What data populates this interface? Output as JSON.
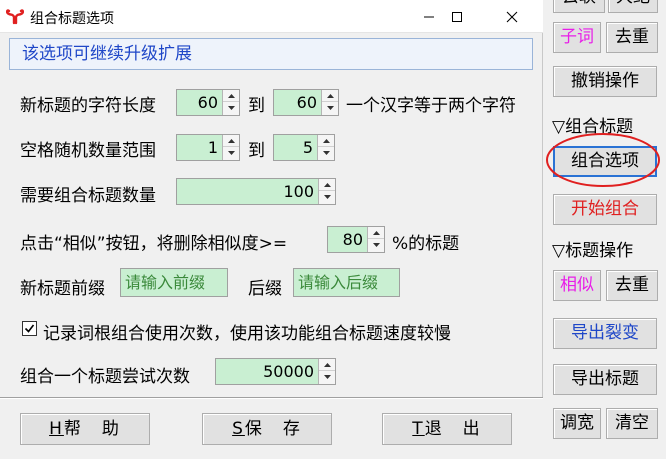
{
  "dialog": {
    "title": "组合标题选项",
    "banner": "该选项可继续升级扩展",
    "rows": {
      "length": {
        "label": "新标题的字符长度",
        "min": "60",
        "to": "到",
        "max": "60",
        "note": "一个汉字等于两个字符"
      },
      "space": {
        "label": "空格随机数量范围",
        "min": "1",
        "to": "到",
        "max": "5"
      },
      "count": {
        "label": "需要组合标题数量",
        "value": "100"
      },
      "similar": {
        "label": "点击“相似”按钮，将删除相似度>=",
        "value": "80",
        "suffix": "%的标题"
      },
      "prefix": {
        "label": "新标题前缀",
        "placeholder": "请输入前缀",
        "suffix_label": "后缀",
        "suffix_placeholder": "请输入后缀"
      },
      "record": {
        "label": "记录词根组合使用次数，使用该功能组合标题速度较慢",
        "checked": true
      },
      "tries": {
        "label": "组合一个标题尝试次数",
        "value": "50000"
      }
    },
    "buttons": {
      "help_key": "H",
      "help": "帮　助",
      "save_key": "S",
      "save": "保　存",
      "exit_key": "T",
      "exit": "退　出"
    }
  },
  "panel": {
    "top_partial_left": "去联",
    "top_partial_right": "大纪",
    "subword": "子词",
    "dedupe1": "去重",
    "undo": "撤销操作",
    "section_combine": "▽组合标题",
    "combine_options": "组合选项",
    "start_combine": "开始组合",
    "section_title_ops": "▽标题操作",
    "similar": "相似",
    "dedupe2": "去重",
    "export_split": "导出裂变",
    "export_titles": "导出标题",
    "widen": "调宽",
    "clear": "清空"
  },
  "colors": {
    "banner_text": "#1f47c8",
    "field_bg": "#c9efd2",
    "accent_magenta": "#e81ee8",
    "accent_red": "#e02020",
    "accent_blue": "#1f47c8",
    "highlight_ellipse": "#e02020",
    "close_hover": "#e81123"
  },
  "icons": {
    "app": "red-ram-icon",
    "minimize": "minimize-icon",
    "maximize": "maximize-icon",
    "close": "close-icon",
    "spin_up": "spin-up-icon",
    "spin_down": "spin-down-icon",
    "check": "checkmark-icon"
  }
}
